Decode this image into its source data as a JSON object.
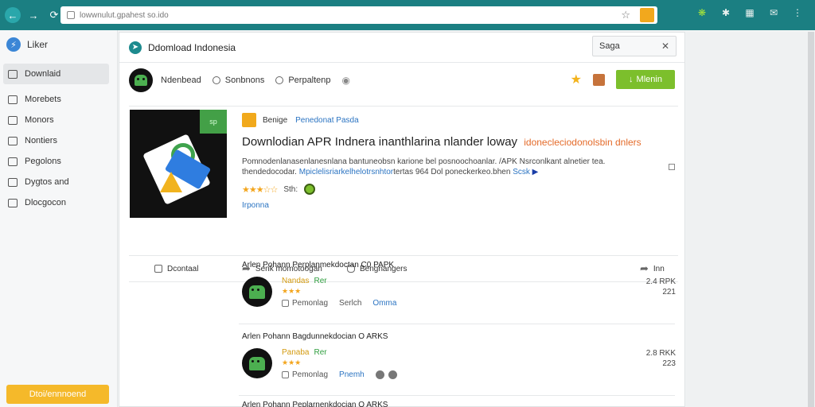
{
  "browser": {
    "url": "lowwnulut.gpahest so.ido",
    "back_icon": "arrow-left-icon",
    "forward_icon": "arrow-right-icon",
    "reload_icon": "reload-icon"
  },
  "sidebar": {
    "title": "Liker",
    "items": [
      {
        "label": "Downlaid",
        "active": true
      },
      {
        "label": "Morebets"
      },
      {
        "label": "Monors"
      },
      {
        "label": "Nontiers"
      },
      {
        "label": "Pegolons"
      },
      {
        "label": "Dygtos and"
      },
      {
        "label": "Dlocgocon"
      }
    ],
    "cta": "Dtoi/ennnoend"
  },
  "main": {
    "title": "Ddomload Indonesia",
    "search": {
      "value": "Saga"
    },
    "toolbar": {
      "items": [
        "Ndenbead",
        "Sonbnons",
        "Perpaltenp"
      ],
      "download_label": "Mlenin"
    },
    "hero": {
      "publisher_label": "Benige",
      "publisher_link": "Penedonat Pasda",
      "badge": "sp",
      "title": "Downlodian APR Indnera inanthlarina nlander loway",
      "title_accent": "idonecleciodonolsbin dnlers",
      "desc_line1": "Pomnodenlanasenlanesnlana bantuneobsn karione bel posnoochoanlar. /APK Nsrconlkant alnetier tea.",
      "desc_line2a": "thendedocodar. ",
      "desc_link": "Mpiclelisriarkelhelotrsnhtor",
      "desc_line2b": "tertas 964 Dol poneckerkeo.bhen ",
      "desc_play": "Scsk",
      "stars": "★★★☆☆",
      "rating_text": "Sth:",
      "more": "Irponna"
    },
    "actions": {
      "left": "Dcontaal",
      "share": "Senk momotoogan",
      "comment": "Bengnangers",
      "right": "Inn"
    },
    "list": [
      {
        "title": "Arlen Pohann Perplanmekdoctan C0 PAPK",
        "name": "Nandas",
        "tag": "Rer",
        "stars": "★★★",
        "meta1": "Pemonlag",
        "meta2": "Serlch",
        "meta3": "Omma",
        "size1": "2.4 RPK",
        "size2": "221"
      },
      {
        "title": "Arlen Pohann Bagdunnekdocian O ARKS",
        "name": "Panaba",
        "tag": "Rer",
        "stars": "★★★",
        "meta1": "Pemonlag",
        "meta2": "Pnemh",
        "meta3": "",
        "size1": "2.8 RKK",
        "size2": "223"
      },
      {
        "title": "Arlen Pohann Peplarnenkdocian O ARKS"
      }
    ]
  }
}
